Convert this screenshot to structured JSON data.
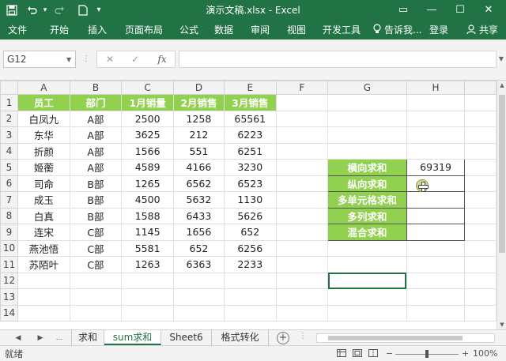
{
  "window": {
    "title": "演示文稿.xlsx - Excel",
    "save_icon": "save-icon",
    "undo_icon": "undo-icon",
    "redo_icon": "redo-icon",
    "new_icon": "new-file-icon",
    "qat_more": "▾",
    "minimize": "—",
    "maximize": "☐",
    "close": "✕",
    "ribbon_display": "▭"
  },
  "ribbon": {
    "tabs": [
      "文件",
      "开始",
      "插入",
      "页面布局",
      "公式",
      "数据",
      "审阅",
      "视图",
      "开发工具"
    ],
    "tellme": "告诉我...",
    "login": "登录",
    "share": "共享"
  },
  "formula_bar": {
    "name_box": "G12",
    "cancel": "✕",
    "enter": "✓",
    "fx": "fx",
    "formula": ""
  },
  "grid": {
    "columns": [
      "A",
      "B",
      "C",
      "D",
      "E",
      "F",
      "G",
      "H"
    ],
    "rows": [
      "1",
      "2",
      "3",
      "4",
      "5",
      "6",
      "7",
      "8",
      "9",
      "10",
      "11",
      "12",
      "13",
      "14"
    ],
    "headers": [
      "员工",
      "部门",
      "1月销量",
      "2月销售",
      "3月销售"
    ],
    "data": [
      [
        "白凤九",
        "A部",
        "2500",
        "1258",
        "65561"
      ],
      [
        "东华",
        "A部",
        "3625",
        "212",
        "6223"
      ],
      [
        "折颜",
        "A部",
        "1566",
        "551",
        "6251"
      ],
      [
        "姬蘅",
        "A部",
        "4589",
        "4166",
        "3230"
      ],
      [
        "司命",
        "B部",
        "1265",
        "6562",
        "6523"
      ],
      [
        "成玉",
        "B部",
        "4500",
        "5632",
        "1130"
      ],
      [
        "白真",
        "B部",
        "1588",
        "6433",
        "5626"
      ],
      [
        "连宋",
        "C部",
        "1145",
        "1656",
        "652"
      ],
      [
        "燕池悟",
        "C部",
        "5581",
        "652",
        "6256"
      ],
      [
        "苏陌叶",
        "C部",
        "1263",
        "6363",
        "2233"
      ]
    ],
    "sum_labels": [
      "横向求和",
      "纵向求和",
      "多单元格求和",
      "多列求和",
      "混合求和"
    ],
    "sum_values": [
      "69319",
      "",
      "",
      "",
      ""
    ]
  },
  "sheets": {
    "nav_prev": "◀",
    "nav_next": "▶",
    "more": "...",
    "tabs": [
      "求和",
      "sum求和",
      "Sheet6",
      "格式转化"
    ],
    "active": "sum求和",
    "add": "+"
  },
  "status": {
    "ready": "就绪",
    "zoom_minus": "−",
    "zoom_plus": "+",
    "zoom": "100%"
  }
}
